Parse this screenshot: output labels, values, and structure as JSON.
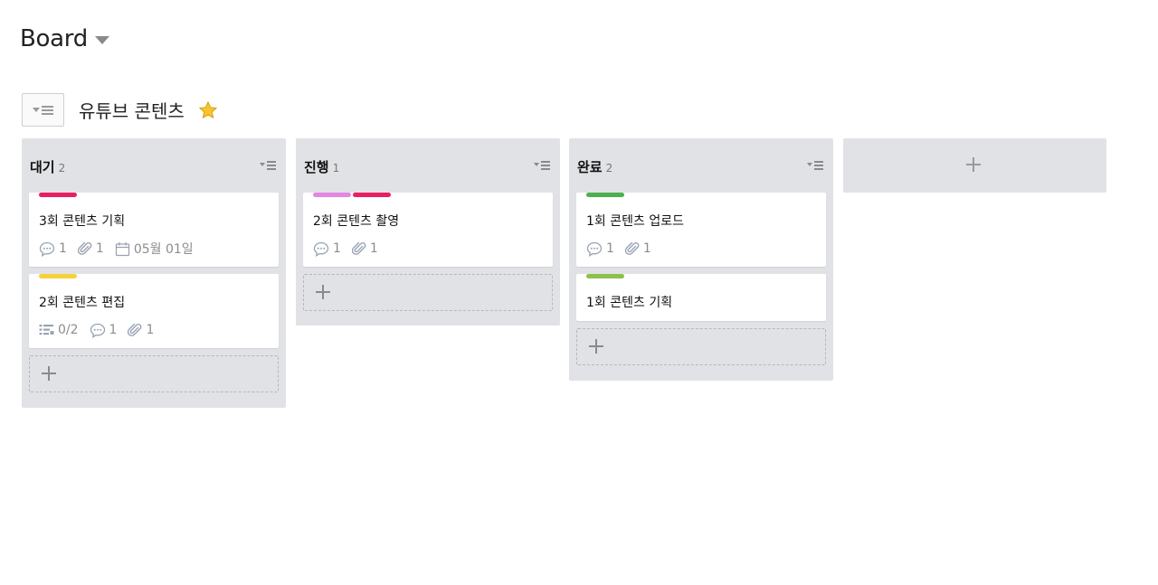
{
  "header": {
    "title": "Board"
  },
  "board": {
    "name": "유튜브 콘텐츠"
  },
  "colors": {
    "pink": "#e91e63",
    "yellow": "#f6d239",
    "violet": "#e387e3",
    "green": "#4caf50",
    "lime": "#8bc34a",
    "column_bg": "#e1e2e6"
  },
  "columns": [
    {
      "title": "대기",
      "count": "2",
      "cards": [
        {
          "title": "3회 콘텐츠 기획",
          "labels": [
            "pink"
          ],
          "comments": "1",
          "attachments": "1",
          "date": "05월 01일"
        },
        {
          "title": "2회 콘텐츠 편집",
          "labels": [
            "yellow"
          ],
          "checklist": "0/2",
          "comments": "1",
          "attachments": "1"
        }
      ]
    },
    {
      "title": "진행",
      "count": "1",
      "cards": [
        {
          "title": "2회 콘텐츠 촬영",
          "labels": [
            "violet",
            "pink"
          ],
          "comments": "1",
          "attachments": "1"
        }
      ]
    },
    {
      "title": "완료",
      "count": "2",
      "cards": [
        {
          "title": "1회 콘텐츠 업로드",
          "labels": [
            "green"
          ],
          "comments": "1",
          "attachments": "1"
        },
        {
          "title": "1회 콘텐츠 기획",
          "labels": [
            "lime"
          ]
        }
      ]
    }
  ]
}
